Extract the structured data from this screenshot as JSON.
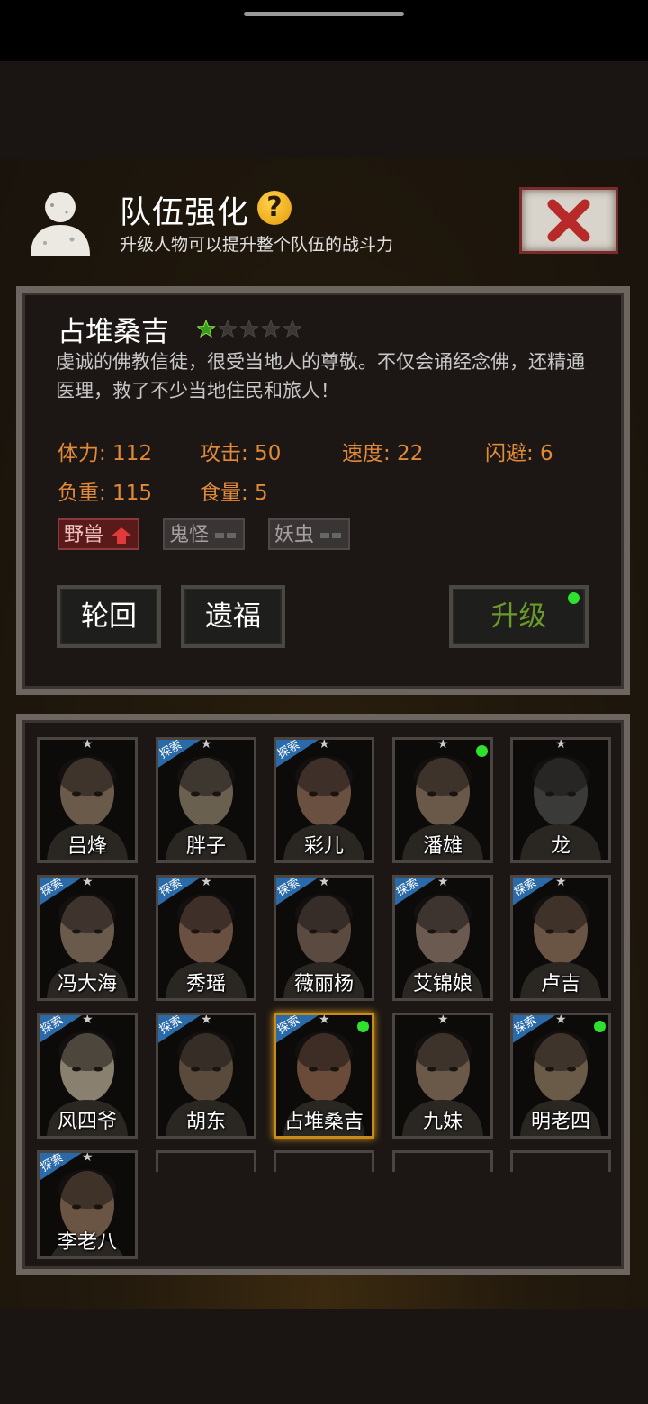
{
  "header": {
    "title": "队伍强化",
    "help_icon": "?",
    "subtitle": "升级人物可以提升整个队伍的战斗力"
  },
  "character": {
    "name": "占堆桑吉",
    "stars_filled": 1,
    "stars_total": 5,
    "description": "虔诚的佛教信徒，很受当地人的尊敬。不仅会诵经念佛，还精通医理，救了不少当地住民和旅人！",
    "stats": [
      {
        "label": "体力: 112"
      },
      {
        "label": "攻击: 50"
      },
      {
        "label": "速度: 22"
      },
      {
        "label": "闪避: 6"
      },
      {
        "label": "负重: 115"
      },
      {
        "label": "食量: 5"
      }
    ],
    "tags": [
      {
        "label": "野兽",
        "state": "up"
      },
      {
        "label": "鬼怪",
        "state": "neutral"
      },
      {
        "label": "妖虫",
        "state": "neutral"
      }
    ]
  },
  "buttons": {
    "reincarnate": "轮回",
    "legacy": "遗福",
    "upgrade": "升级"
  },
  "roster": [
    {
      "name": "吕烽",
      "explore": false,
      "dot": false,
      "tone": "#6a5a4a"
    },
    {
      "name": "胖子",
      "explore": true,
      "dot": false,
      "tone": "#6a6050"
    },
    {
      "name": "彩儿",
      "explore": true,
      "dot": false,
      "tone": "#6a5040"
    },
    {
      "name": "潘雄",
      "explore": false,
      "dot": true,
      "tone": "#6a5848"
    },
    {
      "name": "龙",
      "explore": false,
      "dot": false,
      "tone": "#3a3a38"
    },
    {
      "name": "冯大海",
      "explore": true,
      "dot": false,
      "tone": "#6a5a4c"
    },
    {
      "name": "秀瑶",
      "explore": true,
      "dot": false,
      "tone": "#6a5040"
    },
    {
      "name": "薇丽杨",
      "explore": true,
      "dot": false,
      "tone": "#5a4a40"
    },
    {
      "name": "艾锦娘",
      "explore": true,
      "dot": false,
      "tone": "#6a5a50"
    },
    {
      "name": "卢吉",
      "explore": true,
      "dot": false,
      "tone": "#6a5444"
    },
    {
      "name": "风四爷",
      "explore": true,
      "dot": false,
      "tone": "#8a8070"
    },
    {
      "name": "胡东",
      "explore": true,
      "dot": false,
      "tone": "#5a4a3c"
    },
    {
      "name": "占堆桑吉",
      "explore": true,
      "dot": true,
      "tone": "#6a4a38",
      "selected": true
    },
    {
      "name": "九妹",
      "explore": false,
      "dot": false,
      "tone": "#6a5848"
    },
    {
      "name": "明老四",
      "explore": true,
      "dot": true,
      "tone": "#6a5a48"
    },
    {
      "name": "李老八",
      "explore": true,
      "dot": false,
      "tone": "#6a5444"
    }
  ],
  "explore_badge": "探索",
  "colors": {
    "stat": "#e08a3a",
    "upgrade_text": "#6a9a2a",
    "dot": "#2ee12e",
    "selected_border": "#c88a18"
  }
}
